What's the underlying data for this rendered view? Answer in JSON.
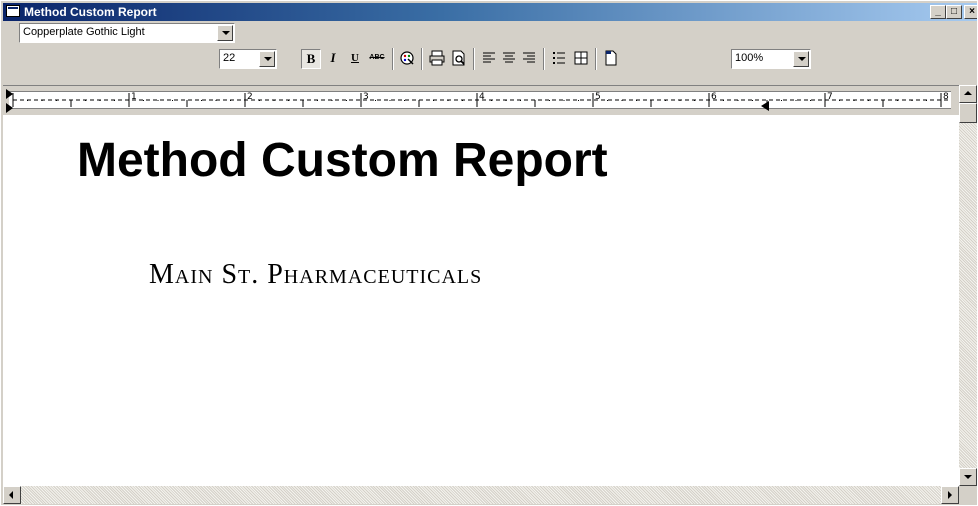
{
  "window": {
    "title": "Method Custom Report",
    "minimize_label": "_",
    "maximize_label": "□",
    "close_label": "×"
  },
  "toolbar": {
    "font_name": "Copperplate Gothic Light",
    "font_size": "22",
    "bold_glyph": "B",
    "italic_glyph": "I",
    "underline_glyph": "U",
    "strike_glyph": "ABC",
    "zoom": "100%",
    "icons": [
      "bold-icon",
      "italic-icon",
      "underline-icon",
      "strikethrough-icon",
      "color-palette-icon",
      "print-icon",
      "print-preview-icon",
      "align-left-icon",
      "align-center-icon",
      "align-right-icon",
      "bullet-list-icon",
      "table-icon",
      "page-setup-icon"
    ]
  },
  "ruler": {
    "numbers": [
      "1",
      "2",
      "3",
      "4",
      "5",
      "6",
      "7",
      "8"
    ]
  },
  "document": {
    "heading": "Method Custom Report",
    "company": "Main St. Pharmaceuticals"
  },
  "colors": {
    "title_start": "#0a246a",
    "title_end": "#a6caf0",
    "chrome": "#d4d0c8"
  }
}
